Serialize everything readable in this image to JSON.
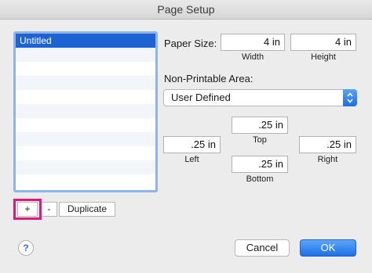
{
  "window": {
    "title": "Page Setup"
  },
  "list": {
    "items": [
      "Untitled"
    ],
    "add_label": "+",
    "remove_label": "-",
    "duplicate_label": "Duplicate"
  },
  "paper_size": {
    "label": "Paper Size:",
    "width_value": "4 in",
    "width_label": "Width",
    "height_value": "4 in",
    "height_label": "Height"
  },
  "non_printable": {
    "label": "Non-Printable Area:",
    "selected": "User Defined",
    "top_value": ".25 in",
    "top_label": "Top",
    "left_value": ".25 in",
    "left_label": "Left",
    "right_value": ".25 in",
    "right_label": "Right",
    "bottom_value": ".25 in",
    "bottom_label": "Bottom"
  },
  "buttons": {
    "help_label": "?",
    "cancel_label": "Cancel",
    "ok_label": "OK"
  },
  "colors": {
    "accent": "#1e63d4",
    "highlight": "#e0187e"
  }
}
